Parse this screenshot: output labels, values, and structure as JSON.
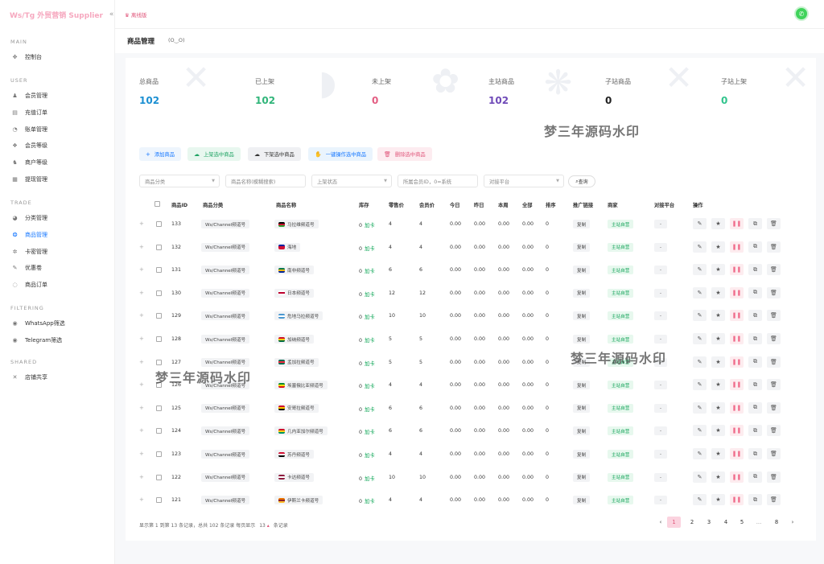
{
  "brand": {
    "name": "Ws/Tg 外贸营销 Supplier",
    "collapse_icon": "«"
  },
  "sidebar": {
    "sections": [
      {
        "title": "MAIN",
        "items": [
          {
            "label": "控制台",
            "icon": "dashboard-icon",
            "glyph": "✥"
          }
        ]
      },
      {
        "title": "USER",
        "items": [
          {
            "label": "会员管理",
            "icon": "user-icon",
            "glyph": "♟"
          },
          {
            "label": "充值订单",
            "icon": "order-icon",
            "glyph": "▤"
          },
          {
            "label": "账单管理",
            "icon": "bill-icon",
            "glyph": "◔"
          },
          {
            "label": "会员等级",
            "icon": "level-icon",
            "glyph": "❖"
          },
          {
            "label": "商户等级",
            "icon": "merchant-icon",
            "glyph": "♞"
          },
          {
            "label": "提现管理",
            "icon": "withdraw-icon",
            "glyph": "▦"
          }
        ]
      },
      {
        "title": "TRADE",
        "items": [
          {
            "label": "分类管理",
            "icon": "category-icon",
            "glyph": "◕"
          },
          {
            "label": "商品管理",
            "icon": "product-icon",
            "glyph": "❂",
            "active": true
          },
          {
            "label": "卡密管理",
            "icon": "card-key-icon",
            "glyph": "✲"
          },
          {
            "label": "优惠卷",
            "icon": "coupon-icon",
            "glyph": "✎"
          },
          {
            "label": "商品订单",
            "icon": "product-order-icon",
            "glyph": "◌"
          }
        ]
      },
      {
        "title": "FILTERING",
        "items": [
          {
            "label": "WhatsApp筛选",
            "icon": "whatsapp-filter-icon",
            "glyph": "◉"
          },
          {
            "label": "Telegram筛选",
            "icon": "telegram-filter-icon",
            "glyph": "◉"
          }
        ]
      },
      {
        "title": "SHARED",
        "items": [
          {
            "label": "店铺共享",
            "icon": "share-icon",
            "glyph": "✕"
          }
        ]
      }
    ]
  },
  "topbar": {
    "offline_label": "♛ 离线版",
    "avatar_glyph": "✆"
  },
  "page": {
    "title": "商品管理",
    "subtitle": "(O‿O)"
  },
  "stats": [
    {
      "label": "总商品",
      "value": "102",
      "color": "#1b8fd2"
    },
    {
      "label": "已上架",
      "value": "102",
      "color": "#31b57a"
    },
    {
      "label": "未上架",
      "value": "0",
      "color": "#e35d82"
    },
    {
      "label": "主站商品",
      "value": "102",
      "color": "#6f4ab8"
    },
    {
      "label": "子站商品",
      "value": "0",
      "color": "#222222"
    },
    {
      "label": "子站上架",
      "value": "0",
      "color": "#31c48d"
    }
  ],
  "watermark": "梦三年源码水印",
  "actions": [
    {
      "label": "添加商品",
      "icon": "plus-icon",
      "glyph": "+",
      "bg": "#eef5fd",
      "fg": "#1677ff"
    },
    {
      "label": "上架选中商品",
      "icon": "cloud-up-icon",
      "glyph": "☁",
      "bg": "#e8f7ef",
      "fg": "#1fa363"
    },
    {
      "label": "下架选中商品",
      "icon": "cloud-down-icon",
      "glyph": "☁",
      "bg": "#eff0f3",
      "fg": "#333333"
    },
    {
      "label": "一键操作选中商品",
      "icon": "hand-icon",
      "glyph": "✋",
      "bg": "#eaf4fd",
      "fg": "#1677ff"
    },
    {
      "label": "删除选中商品",
      "icon": "trash-icon",
      "glyph": "🗑",
      "bg": "#fdecf0",
      "fg": "#e0557a"
    }
  ],
  "filters": {
    "category": "商品分类",
    "name": "商品名称(模糊搜索)",
    "status": "上架状态",
    "member": "所属会员ID，0=系统",
    "platform": "对接平台",
    "query_label": "查询",
    "query_glyph": "⌕"
  },
  "columns": [
    "商品ID",
    "商品分类",
    "商品名称",
    "库存",
    "零售价",
    "会员价",
    "今日",
    "昨日",
    "本周",
    "全部",
    "排序",
    "推广链接",
    "商家",
    "对接平台",
    "操作"
  ],
  "rows": [
    {
      "id": "133",
      "category": "Ws/Channel频道号",
      "name": "马拉维频道号",
      "flag": [
        "#000000",
        "#c8102e",
        "#339e35"
      ],
      "stock": "0",
      "stock_unit": "加卡",
      "retail": "4",
      "member": "4",
      "today": "0.00",
      "yesterday": "0.00",
      "week": "0.00",
      "all": "0.00",
      "sort": "0",
      "promo": "复制",
      "merchant": "主站自营",
      "platform": "-"
    },
    {
      "id": "132",
      "category": "Ws/Channel频道号",
      "name": "海地",
      "flag": [
        "#00209f",
        "#d21034",
        "#d21034"
      ],
      "stock": "0",
      "stock_unit": "加卡",
      "retail": "4",
      "member": "4",
      "today": "0.00",
      "yesterday": "0.00",
      "week": "0.00",
      "all": "0.00",
      "sort": "0",
      "promo": "复制",
      "merchant": "主站自营",
      "platform": "-"
    },
    {
      "id": "131",
      "category": "Ws/Channel频道号",
      "name": "南非频道号",
      "flag": [
        "#007a4d",
        "#ffb612",
        "#002395"
      ],
      "stock": "0",
      "stock_unit": "加卡",
      "retail": "6",
      "member": "6",
      "today": "0.00",
      "yesterday": "0.00",
      "week": "0.00",
      "all": "0.00",
      "sort": "0",
      "promo": "复制",
      "merchant": "主站自营",
      "platform": "-"
    },
    {
      "id": "130",
      "category": "Ws/Channel频道号",
      "name": "日本频道号",
      "flag": [
        "#ffffff",
        "#bc002d",
        "#ffffff"
      ],
      "stock": "0",
      "stock_unit": "加卡",
      "retail": "12",
      "member": "12",
      "today": "0.00",
      "yesterday": "0.00",
      "week": "0.00",
      "all": "0.00",
      "sort": "0",
      "promo": "复制",
      "merchant": "主站自营",
      "platform": "-"
    },
    {
      "id": "129",
      "category": "Ws/Channel频道号",
      "name": "危地马拉频道号",
      "flag": [
        "#4997d0",
        "#ffffff",
        "#4997d0"
      ],
      "stock": "0",
      "stock_unit": "加卡",
      "retail": "10",
      "member": "10",
      "today": "0.00",
      "yesterday": "0.00",
      "week": "0.00",
      "all": "0.00",
      "sort": "0",
      "promo": "复制",
      "merchant": "主站自营",
      "platform": "-"
    },
    {
      "id": "128",
      "category": "Ws/Channel频道号",
      "name": "加纳频道号",
      "flag": [
        "#ce1126",
        "#fcd116",
        "#006b3f"
      ],
      "stock": "0",
      "stock_unit": "加卡",
      "retail": "5",
      "member": "5",
      "today": "0.00",
      "yesterday": "0.00",
      "week": "0.00",
      "all": "0.00",
      "sort": "0",
      "promo": "复制",
      "merchant": "主站自营",
      "platform": "-"
    },
    {
      "id": "127",
      "category": "Ws/Channel频道号",
      "name": "孟加拉频道号",
      "flag": [
        "#006a4e",
        "#f42a41",
        "#006a4e"
      ],
      "stock": "0",
      "stock_unit": "加卡",
      "retail": "5",
      "member": "5",
      "today": "0.00",
      "yesterday": "0.00",
      "week": "0.00",
      "all": "0.00",
      "sort": "0",
      "promo": "复制",
      "merchant": "主站自营",
      "platform": "-"
    },
    {
      "id": "126",
      "category": "Ws/Channel频道号",
      "name": "埃塞俄比亚频道号",
      "flag": [
        "#078930",
        "#fcdd09",
        "#da121a"
      ],
      "stock": "0",
      "stock_unit": "加卡",
      "retail": "4",
      "member": "4",
      "today": "0.00",
      "yesterday": "0.00",
      "week": "0.00",
      "all": "0.00",
      "sort": "0",
      "promo": "复制",
      "merchant": "主站自营",
      "platform": "-"
    },
    {
      "id": "125",
      "category": "Ws/Channel频道号",
      "name": "安哥拉频道号",
      "flag": [
        "#cc092f",
        "#ffcb00",
        "#000000"
      ],
      "stock": "0",
      "stock_unit": "加卡",
      "retail": "6",
      "member": "6",
      "today": "0.00",
      "yesterday": "0.00",
      "week": "0.00",
      "all": "0.00",
      "sort": "0",
      "promo": "复制",
      "merchant": "主站自营",
      "platform": "-"
    },
    {
      "id": "124",
      "category": "Ws/Channel频道号",
      "name": "几内亚加尔频道号",
      "flag": [
        "#ce1126",
        "#fcd116",
        "#009460"
      ],
      "stock": "0",
      "stock_unit": "加卡",
      "retail": "6",
      "member": "6",
      "today": "0.00",
      "yesterday": "0.00",
      "week": "0.00",
      "all": "0.00",
      "sort": "0",
      "promo": "复制",
      "merchant": "主站自营",
      "platform": "-"
    },
    {
      "id": "123",
      "category": "Ws/Channel频道号",
      "name": "苏丹频道号",
      "flag": [
        "#d21034",
        "#ffffff",
        "#000000"
      ],
      "stock": "0",
      "stock_unit": "加卡",
      "retail": "4",
      "member": "4",
      "today": "0.00",
      "yesterday": "0.00",
      "week": "0.00",
      "all": "0.00",
      "sort": "0",
      "promo": "复制",
      "merchant": "主站自营",
      "platform": "-"
    },
    {
      "id": "122",
      "category": "Ws/Channel频道号",
      "name": "卡达频道号",
      "flag": [
        "#8d1b3d",
        "#ffffff",
        "#8d1b3d"
      ],
      "stock": "0",
      "stock_unit": "加卡",
      "retail": "10",
      "member": "10",
      "today": "0.00",
      "yesterday": "0.00",
      "week": "0.00",
      "all": "0.00",
      "sort": "0",
      "promo": "复制",
      "merchant": "主站自营",
      "platform": "-"
    },
    {
      "id": "121",
      "category": "Ws/Channel频道号",
      "name": "伊斯兰卡频道号",
      "flag": [
        "#eb7400",
        "#8d2029",
        "#ffbe29"
      ],
      "stock": "0",
      "stock_unit": "加卡",
      "retail": "4",
      "member": "4",
      "today": "0.00",
      "yesterday": "0.00",
      "week": "0.00",
      "all": "0.00",
      "sort": "0",
      "promo": "复制",
      "merchant": "主站自营",
      "platform": "-"
    }
  ],
  "row_actions": [
    {
      "name": "edit-icon",
      "glyph": "✎",
      "bg": "#f2f3f5",
      "fg": "#555555"
    },
    {
      "name": "star-icon",
      "glyph": "★",
      "bg": "#f2f3f5",
      "fg": "#555555"
    },
    {
      "name": "pause-icon",
      "glyph": "❚❚",
      "bg": "#fdecef",
      "fg": "#f06a8a"
    },
    {
      "name": "copy-icon",
      "glyph": "⧉",
      "bg": "#f2f3f5",
      "fg": "#555555"
    },
    {
      "name": "delete-icon",
      "glyph": "🗑",
      "bg": "#f2f3f5",
      "fg": "#555555"
    }
  ],
  "footer": {
    "info_prefix": "显示第 1 到第 13 条记录，总共 102 条记录  每页显示",
    "page_size": "13",
    "page_size_caret": "▴",
    "info_suffix": "条记录"
  },
  "pagination": {
    "prev": "‹",
    "pages": [
      "1",
      "2",
      "3",
      "4",
      "5",
      "...",
      "8"
    ],
    "next": "›",
    "current": "1",
    "active_color": "#fbd3df"
  }
}
